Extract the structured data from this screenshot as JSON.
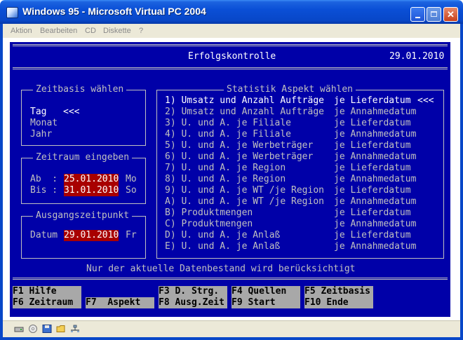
{
  "window": {
    "title": "Windows 95 - Microsoft Virtual PC 2004",
    "menu": [
      "Aktion",
      "Bearbeiten",
      "CD",
      "Diskette",
      "?"
    ],
    "status_icons": [
      "disk-drive-icon",
      "cd-icon",
      "floppy-icon",
      "folder-icon",
      "network-icon"
    ]
  },
  "dos": {
    "header_title": "Erfolgskontrolle",
    "header_date": "29.01.2010",
    "zeitbasis": {
      "title": "Zeitbasis wählen",
      "options": [
        "Tag",
        "Monat",
        "Jahr"
      ],
      "selected_marker": "<<<"
    },
    "zeitraum": {
      "title": "Zeitraum eingeben",
      "ab_label": "Ab  :",
      "ab_value": "25.01.2010",
      "ab_day": "Mo",
      "bis_label": "Bis :",
      "bis_value": "31.01.2010",
      "bis_day": "So"
    },
    "ausgang": {
      "title": "Ausgangszeitpunkt",
      "label": "Datum",
      "value": "29.01.2010",
      "day": "Fr"
    },
    "statistik": {
      "title": "Statistik Aspekt wählen",
      "items": [
        {
          "label": "1) Umsatz und Anzahl Aufträge",
          "mode": "je Lieferdatum",
          "marker": "<<<"
        },
        {
          "label": "2) Umsatz und Anzahl Aufträge",
          "mode": "je Annahmedatum",
          "marker": ""
        },
        {
          "label": "3) U. und A. je Filiale",
          "mode": "je Lieferdatum",
          "marker": ""
        },
        {
          "label": "4) U. und A. je Filiale",
          "mode": "je Annahmedatum",
          "marker": ""
        },
        {
          "label": "5) U. und A. je Werbeträger",
          "mode": "je Lieferdatum",
          "marker": ""
        },
        {
          "label": "6) U. und A. je Werbeträger",
          "mode": "je Annahmedatum",
          "marker": ""
        },
        {
          "label": "7) U. und A. je Region",
          "mode": "je Lieferdatum",
          "marker": ""
        },
        {
          "label": "8) U. und A. je Region",
          "mode": "je Annahmedatum",
          "marker": ""
        },
        {
          "label": "9) U. und A. je WT /je Region",
          "mode": "je Lieferdatum",
          "marker": ""
        },
        {
          "label": "A) U. und A. je WT /je Region",
          "mode": "je Annahmedatum",
          "marker": ""
        },
        {
          "label": "B) Produktmengen",
          "mode": "je Lieferdatum",
          "marker": ""
        },
        {
          "label": "C) Produktmengen",
          "mode": "je Annahmedatum",
          "marker": ""
        },
        {
          "label": "D) U. und A. je Anlaß",
          "mode": "je Lieferdatum",
          "marker": ""
        },
        {
          "label": "E) U. und A. je Anlaß",
          "mode": "je Annahmedatum",
          "marker": ""
        }
      ]
    },
    "footer_note": "Nur der aktuelle Datenbestand wird berücksichtigt",
    "fkeys": [
      {
        "key": "F1",
        "label": "Hilfe"
      },
      {
        "key": "F6",
        "label": "Zeitraum"
      },
      {
        "key": "F7",
        "label": "Aspekt"
      },
      {
        "key": "F3",
        "label": "D. Strg."
      },
      {
        "key": "F8",
        "label": "Ausg.Zeit"
      },
      {
        "key": "F4",
        "label": "Quellen"
      },
      {
        "key": "F9",
        "label": "Start"
      },
      {
        "key": "F5",
        "label": "Zeitbasis"
      },
      {
        "key": "F10",
        "label": "Ende"
      }
    ]
  }
}
